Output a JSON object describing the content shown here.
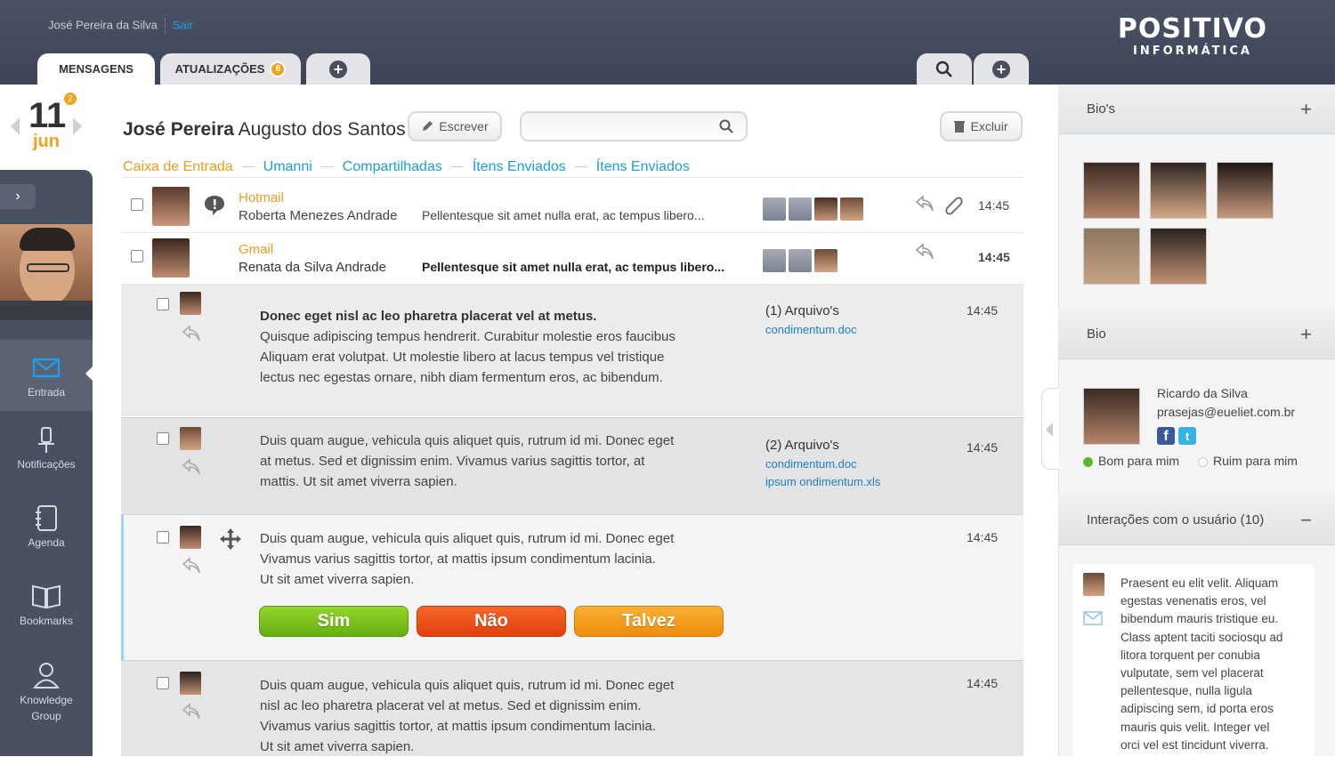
{
  "header": {
    "user_name": "José Pereira da Silva",
    "logout": "Sair",
    "logo_line1": "POSITIVO",
    "logo_line2": "INFORMÁTICA"
  },
  "tabs": [
    {
      "label": "MENSAGENS"
    },
    {
      "label": "ATUALIZAÇÕES",
      "badge": "6"
    }
  ],
  "date": {
    "day": "11",
    "month": "jun",
    "badge": "2"
  },
  "nav": [
    {
      "label": "Entrada",
      "icon": "envelope-icon"
    },
    {
      "label": "Notificações",
      "icon": "pin-icon"
    },
    {
      "label": "Agenda",
      "icon": "agenda-icon"
    },
    {
      "label": "Bookmarks",
      "icon": "book-icon"
    },
    {
      "label_1": "Knowledge",
      "label_2": "Group",
      "icon": "group-icon"
    }
  ],
  "main": {
    "contact_first": "José Pereira",
    "contact_last": " Augusto dos Santos",
    "compose": "Escrever",
    "delete": "Excluir",
    "search_placeholder": "",
    "folders": [
      "Caixa de Entrada",
      "Umanni",
      "Compartilhadas",
      "Ítens Enviados",
      "Ítens Enviados"
    ],
    "messages": [
      {
        "source": "Hotmail",
        "sender": "Roberta Menezes Andrade",
        "preview": "Pellentesque sit amet nulla erat, ac tempus libero...",
        "time": "14:45"
      },
      {
        "source": "Gmail",
        "sender": "Renata da Silva Andrade",
        "preview": "Pellentesque sit amet nulla erat, ac tempus libero...",
        "time": "14:45"
      }
    ],
    "thread": [
      {
        "title": "Donec eget nisl ac leo pharetra placerat vel at metus.",
        "lines": [
          "Quisque adipiscing tempus hendrerit. Curabitur molestie eros faucibus",
          "Aliquam erat volutpat. Ut molestie libero at lacus tempus vel tristique",
          "lectus nec egestas ornare, nibh diam fermentum eros, ac bibendum."
        ],
        "attach_title": "(1) Arquivo's",
        "attach": [
          "condimentum.doc"
        ],
        "time": "14:45"
      },
      {
        "lines": [
          "Duis quam augue, vehicula quis aliquet quis, rutrum id mi. Donec eget",
          "at metus. Sed et dignissim enim. Vivamus varius sagittis tortor, at",
          "mattis. Ut sit amet viverra sapien."
        ],
        "attach_title": "(2) Arquivo's",
        "attach": [
          "condimentum.doc",
          "ipsum ondimentum.xls"
        ],
        "time": "14:45"
      },
      {
        "lines": [
          "Duis quam augue, vehicula quis aliquet quis, rutrum id mi. Donec eget",
          "Vivamus varius sagittis tortor, at mattis ipsum condimentum lacinia.",
          "Ut sit amet viverra sapien."
        ],
        "time": "14:45",
        "votes": [
          "Sim",
          "Não",
          "Talvez"
        ]
      },
      {
        "lines": [
          "Duis quam augue, vehicula quis aliquet quis, rutrum id mi. Donec eget",
          "nisl ac leo pharetra placerat vel at metus. Sed et dignissim enim.",
          "Vivamus varius sagittis tortor, at mattis ipsum condimentum lacinia.",
          "Ut sit amet viverra sapien."
        ],
        "time": "14:45"
      }
    ]
  },
  "right": {
    "bios_title": "Bio's",
    "bio_title": "Bio",
    "bio_name": "Ricardo da Silva",
    "bio_email": "prasejas@eueliet.com.br",
    "good": "Bom para mim",
    "bad": "Ruim para mim",
    "interactions_title": "Interações com o usuário (10)",
    "interaction_text": [
      "Praesent eu elit velit. Aliquam",
      "egestas venenatis eros, vel",
      "bibendum mauris tristique eu.",
      "Class aptent taciti sociosqu ad",
      "litora torquent per conubia",
      "vulputate, sem vel placerat",
      "pellentesque, nulla ligula",
      "adipiscing sem, id porta eros",
      "mauris quis velit. Integer vel",
      "orci vel est tincidunt viverra."
    ]
  },
  "colors": {
    "accent_orange": "#f39a1a",
    "link_blue": "#1b9fd8",
    "vote_yes": "#7ac21b",
    "vote_no": "#ef4a14",
    "vote_maybe": "#f49a12"
  }
}
